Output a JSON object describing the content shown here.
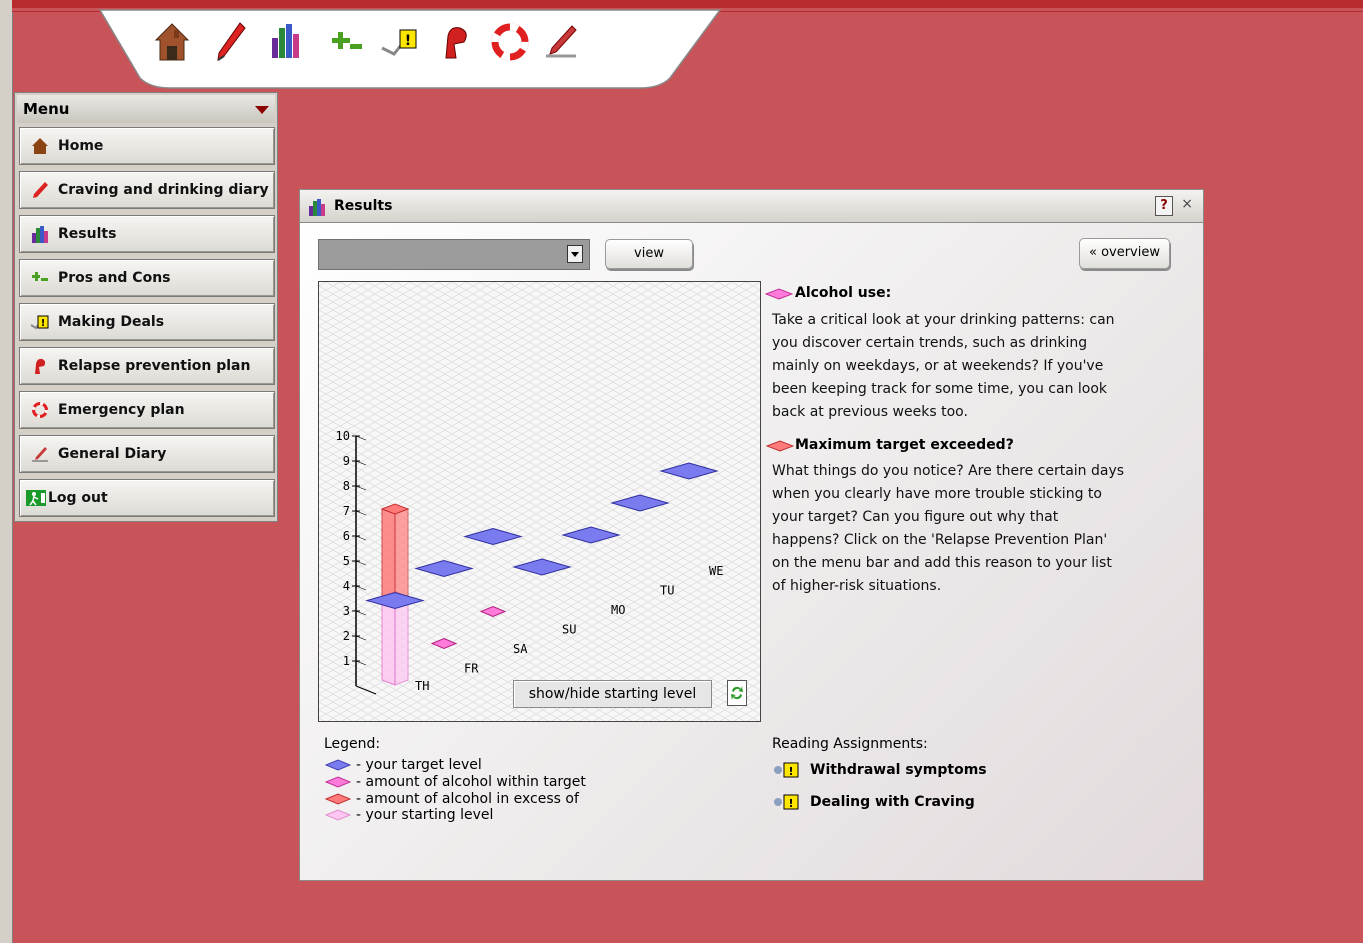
{
  "toolbar": {
    "icons": [
      "house-icon",
      "pen-icon",
      "bar-chart-icon",
      "scale-icon",
      "deal-warning-icon",
      "relapse-icon",
      "lifebuoy-icon",
      "diary-pen-icon"
    ]
  },
  "menu": {
    "title": "Menu",
    "items": [
      {
        "label": "Home",
        "icon": "house-icon"
      },
      {
        "label": "Craving and drinking diary",
        "icon": "pen-icon"
      },
      {
        "label": "Results",
        "icon": "bar-chart-icon"
      },
      {
        "label": "Pros and Cons",
        "icon": "scale-icon"
      },
      {
        "label": "Making Deals",
        "icon": "deal-warning-icon"
      },
      {
        "label": "Relapse prevention plan",
        "icon": "relapse-icon"
      },
      {
        "label": "Emergency plan",
        "icon": "lifebuoy-icon"
      },
      {
        "label": "General Diary",
        "icon": "diary-pen-icon"
      },
      {
        "label": "Log out",
        "icon": "exit-icon"
      }
    ]
  },
  "window": {
    "title": "Results",
    "help": "?",
    "close": "×",
    "view_label": "view",
    "overview_label": "« overview",
    "select_value": ""
  },
  "chart_data": {
    "type": "bar",
    "y_ticks": [
      "1",
      "2",
      "3",
      "4",
      "5",
      "6",
      "7",
      "8",
      "9",
      "10"
    ],
    "ylim": [
      0,
      10
    ],
    "categories": [
      "TH",
      "FR",
      "SA",
      "SU",
      "MO",
      "TU",
      "WE"
    ],
    "series": [
      {
        "name": "your target level",
        "values": [
          3.5,
          4.0,
          4.5,
          2.5,
          3.0,
          3.5,
          4.0
        ]
      },
      {
        "name": "amount of alcohol within target",
        "values": [
          null,
          1.0,
          1.5,
          null,
          null,
          null,
          null
        ]
      },
      {
        "name": "amount of alcohol in excess of",
        "values": [
          7.0,
          null,
          null,
          null,
          null,
          null,
          null
        ]
      },
      {
        "name": "your starting level",
        "values": [
          3.5,
          null,
          null,
          null,
          null,
          null,
          null
        ]
      }
    ],
    "toggle_label": "show/hide starting level",
    "colors": {
      "target": "#7b7bf0",
      "within": "#ff7ad9",
      "excess": "#ff7b7b",
      "starting": "#ffc6f2"
    }
  },
  "info": {
    "alcohol_title": "Alcohol use:",
    "alcohol_text": "Take a critical look at your drinking patterns: can\nyou discover certain trends, such as drinking\nmainly on weekdays, or at weekends? If you've\nbeen keeping track for some time, you can look\nback at previous weeks too.",
    "exceeded_title": "Maximum target exceeded?",
    "exceeded_text": "What things do you notice? Are there certain days\nwhen you clearly have more trouble sticking to\nyour target? Can you figure out why that\nhappens? Click on the 'Relapse Prevention Plan'\non the menu bar and add this reason to your list\nof higher-risk situations."
  },
  "legend": {
    "title": "Legend:",
    "items": [
      {
        "text": "- your target level",
        "color": "#7b7bf0"
      },
      {
        "text": "- amount of alcohol within target",
        "color": "#ff7ad9"
      },
      {
        "text": "- amount of alcohol in excess of",
        "color": "#ff7b7b"
      },
      {
        "text": "- your starting level",
        "color": "#ffc6f2"
      }
    ]
  },
  "reading": {
    "title": "Reading Assignments:",
    "items": [
      "Withdrawal symptoms",
      "Dealing with Craving"
    ]
  }
}
